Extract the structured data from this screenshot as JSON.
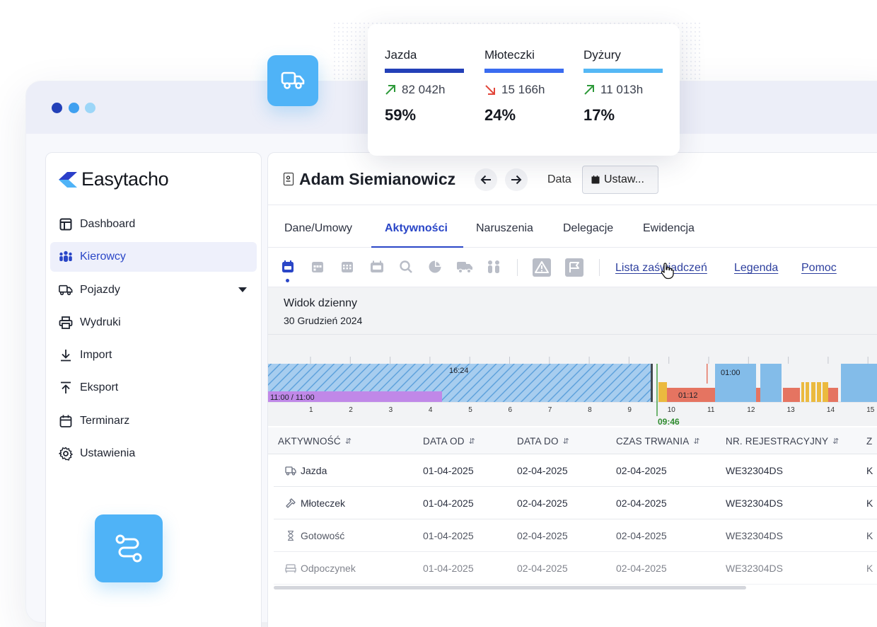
{
  "stats": [
    {
      "label": "Jazda",
      "hours": "82 042h",
      "percent": "59%",
      "trend": "up",
      "color": "#2340b8"
    },
    {
      "label": "Młoteczki",
      "hours": "15 166h",
      "percent": "24%",
      "trend": "down",
      "color": "#3a6cf0"
    },
    {
      "label": "Dyżury",
      "hours": "11 013h",
      "percent": "17%",
      "trend": "up",
      "color": "#55b8f5"
    }
  ],
  "window_dots": [
    "#2340b8",
    "#3fa0f0",
    "#9cd6f8"
  ],
  "brand": {
    "name": "Easytacho"
  },
  "nav": [
    {
      "label": "Dashboard",
      "icon": "layout-icon",
      "active": false
    },
    {
      "label": "Kierowcy",
      "icon": "drivers-icon",
      "active": true
    },
    {
      "label": "Pojazdy",
      "icon": "truck-icon",
      "active": false,
      "expandable": true
    },
    {
      "label": "Wydruki",
      "icon": "printer-icon",
      "active": false
    },
    {
      "label": "Import",
      "icon": "import-icon",
      "active": false
    },
    {
      "label": "Eksport",
      "icon": "export-icon",
      "active": false
    },
    {
      "label": "Terminarz",
      "icon": "calendar-icon",
      "active": false
    },
    {
      "label": "Ustawienia",
      "icon": "gear-icon",
      "active": false
    }
  ],
  "header": {
    "name": "Adam Siemianowicz",
    "date_label": "Data",
    "date_button": "Ustaw..."
  },
  "tabs": [
    {
      "label": "Dane/Umowy",
      "active": false
    },
    {
      "label": "Aktywności",
      "active": true
    },
    {
      "label": "Naruszenia",
      "active": false
    },
    {
      "label": "Delegacje",
      "active": false
    },
    {
      "label": "Ewidencja",
      "active": false
    }
  ],
  "toolbar": {
    "links": [
      "Lista zaświadczeń",
      "Legenda",
      "Pomoc"
    ]
  },
  "day_view": {
    "title": "Widok dzienny",
    "date": "30 Grudzień 2024",
    "rest_label": "16:24",
    "purple_label": "11:00 / 11:00",
    "red_label": "01:12",
    "blue_label": "01:00",
    "current_time": "09:46",
    "hours": [
      "1",
      "2",
      "3",
      "4",
      "5",
      "6",
      "7",
      "8",
      "9",
      "10",
      "11",
      "12",
      "13",
      "14",
      "15"
    ]
  },
  "table": {
    "columns": [
      "AKTYWNOŚĆ",
      "DATA OD",
      "DATA DO",
      "CZAS TRWANIA",
      "NR. REJESTRACYJNY",
      "Z"
    ],
    "rows": [
      {
        "activity": "Jazda",
        "icon": "truck-icon",
        "from": "01-04-2025",
        "to": "02-04-2025",
        "duration": "02-04-2025",
        "reg": "WE32304DS",
        "z": "K"
      },
      {
        "activity": "Młoteczek",
        "icon": "hammer-icon",
        "from": "01-04-2025",
        "to": "02-04-2025",
        "duration": "02-04-2025",
        "reg": "WE32304DS",
        "z": "K"
      },
      {
        "activity": "Gotowość",
        "icon": "hourglass-icon",
        "from": "01-04-2025",
        "to": "02-04-2025",
        "duration": "02-04-2025",
        "reg": "WE32304DS",
        "z": "K"
      },
      {
        "activity": "Odpoczynek",
        "icon": "bed-icon",
        "from": "01-04-2025",
        "to": "02-04-2025",
        "duration": "02-04-2025",
        "reg": "WE32304DS",
        "z": "K"
      }
    ]
  },
  "colors": {
    "accent": "#2a46c7",
    "fab": "#4fb3f7",
    "link": "#2d3f9e"
  }
}
